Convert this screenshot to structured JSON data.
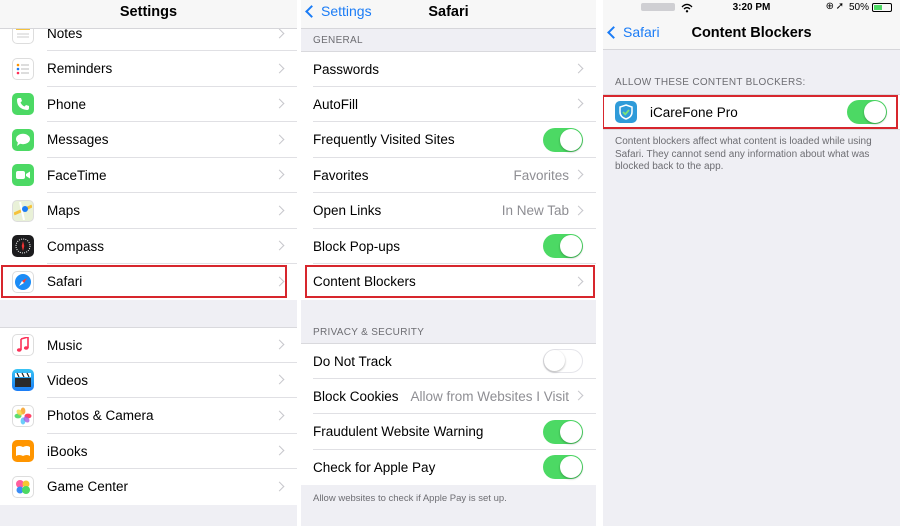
{
  "colors": {
    "accent": "#1b7cf6",
    "toggle_on": "#4cd964",
    "highlight": "#d7262d"
  },
  "panel1": {
    "title": "Settings",
    "rows_top": [
      {
        "label": "Notes",
        "icon": "notes-icon"
      },
      {
        "label": "Reminders",
        "icon": "reminders-icon"
      },
      {
        "label": "Phone",
        "icon": "phone-icon"
      },
      {
        "label": "Messages",
        "icon": "messages-icon"
      },
      {
        "label": "FaceTime",
        "icon": "facetime-icon"
      },
      {
        "label": "Maps",
        "icon": "maps-icon"
      },
      {
        "label": "Compass",
        "icon": "compass-icon"
      },
      {
        "label": "Safari",
        "icon": "safari-icon"
      }
    ],
    "rows_bottom": [
      {
        "label": "Music",
        "icon": "music-icon"
      },
      {
        "label": "Videos",
        "icon": "videos-icon"
      },
      {
        "label": "Photos & Camera",
        "icon": "photos-icon"
      },
      {
        "label": "iBooks",
        "icon": "ibooks-icon"
      },
      {
        "label": "Game Center",
        "icon": "game-center-icon"
      }
    ]
  },
  "panel2": {
    "back": "Settings",
    "title": "Safari",
    "general_header": "GENERAL",
    "passwords": "Passwords",
    "autofill": "AutoFill",
    "frequently_visited": "Frequently Visited Sites",
    "favorites": "Favorites",
    "favorites_value": "Favorites",
    "open_links": "Open Links",
    "open_links_value": "In New Tab",
    "block_popups": "Block Pop-ups",
    "content_blockers": "Content Blockers",
    "privacy_header": "PRIVACY & SECURITY",
    "do_not_track": "Do Not Track",
    "block_cookies": "Block Cookies",
    "block_cookies_value": "Allow from Websites I Visit",
    "fraudulent": "Fraudulent Website Warning",
    "apple_pay": "Check for Apple Pay",
    "apple_pay_footer": "Allow websites to check if Apple Pay is set up."
  },
  "panel3": {
    "status_time": "3:20 PM",
    "battery": "50%",
    "back": "Safari",
    "title": "Content Blockers",
    "section_header": "ALLOW THESE CONTENT BLOCKERS:",
    "app_name": "iCareFone Pro",
    "footer": "Content blockers affect what content is loaded while using Safari. They cannot send any information about what was blocked back to the app."
  }
}
